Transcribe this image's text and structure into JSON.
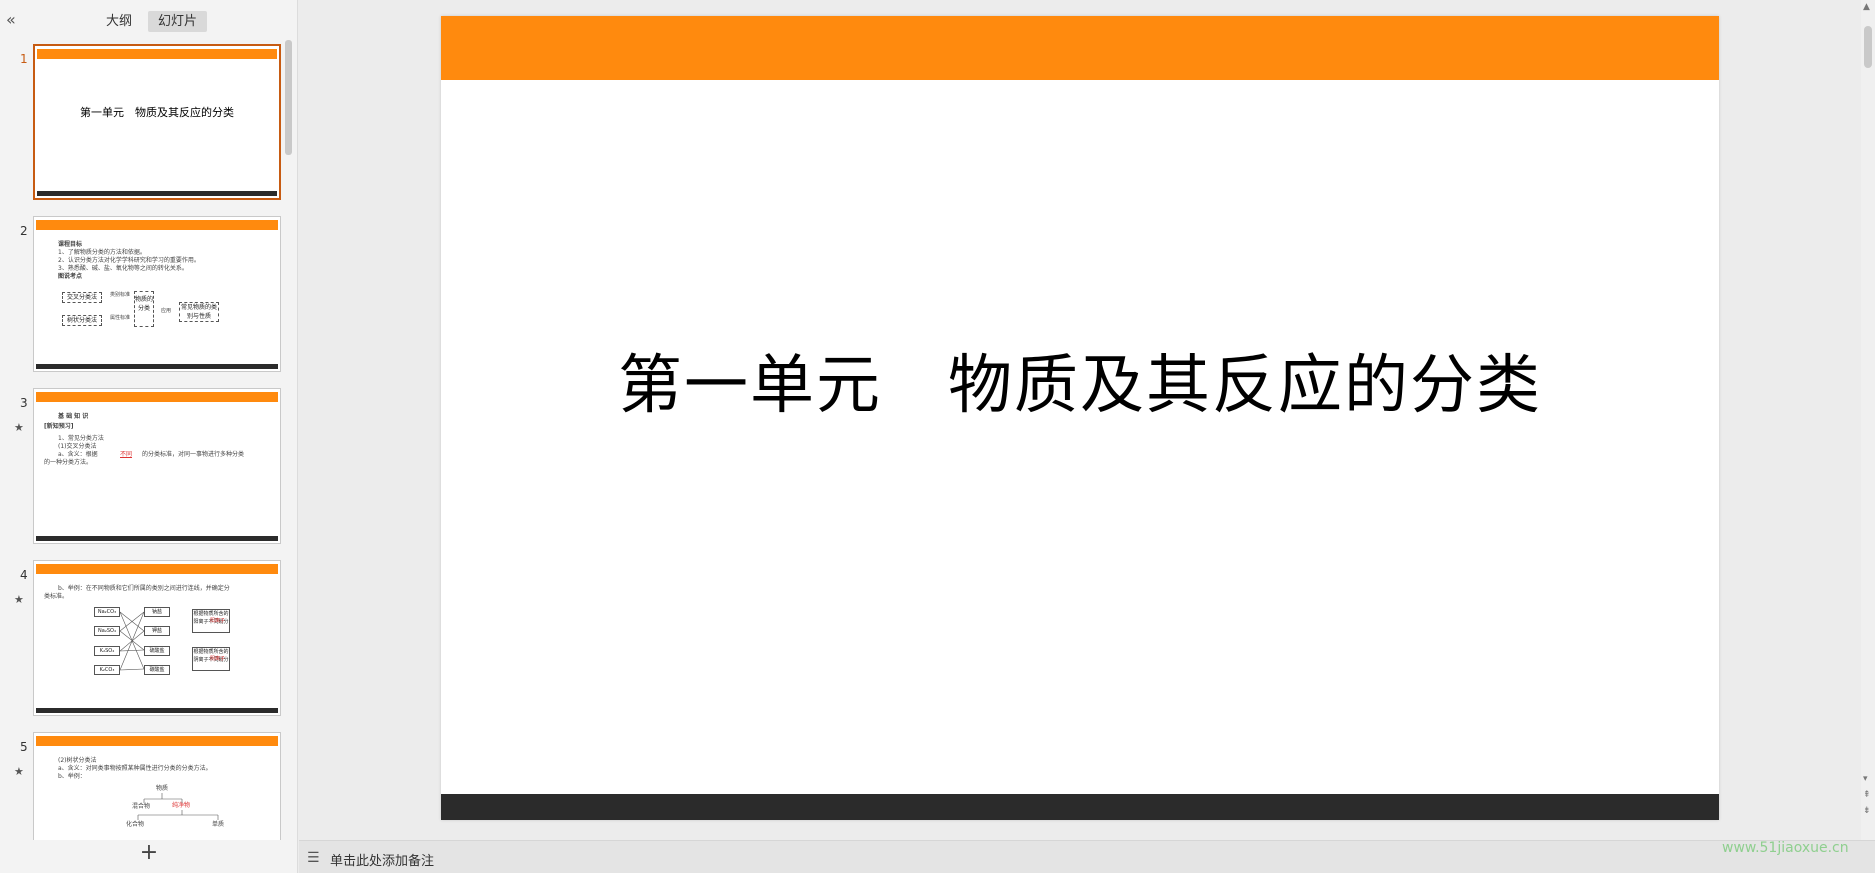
{
  "left_panel": {
    "collapse_icon": "«",
    "tabs": [
      {
        "label": "大纲",
        "active": false
      },
      {
        "label": "幻灯片",
        "active": true
      }
    ],
    "add_icon": "+"
  },
  "thumbnails": [
    {
      "number": "1",
      "title": "第一单元　物质及其反应的分类"
    },
    {
      "number": "2",
      "lines": [
        "课程目标",
        "1、了解物质分类的方法和依据。",
        "2、认识分类方法对化学学科研究和学习的重要作用。",
        "3、熟悉酸、碱、盐、氧化物等之间的转化关系。",
        "图说考点"
      ],
      "boxes": [
        "交叉分类法",
        "树状分类法",
        "物质的分类",
        "常见物质的类别与性质"
      ],
      "small": [
        "类别标准",
        "属性标准",
        "应用"
      ]
    },
    {
      "number": "3",
      "star": "★",
      "lines": [
        "基 础 知 识",
        "[新知预习]",
        "1、常见分类方法",
        "(1)交叉分类法",
        "a、含义：根据",
        "的分类标准，对同一事物进行多种分类",
        "的一种分类方法。"
      ],
      "blank": "不同"
    },
    {
      "number": "4",
      "star": "★",
      "lines": [
        "b、举例：在不同物质和它们所属的类别之间进行连线，并确定分",
        "类标准。"
      ],
      "left_items": [
        "Na₂CO₃",
        "Na₂SO₄",
        "K₂SO₄",
        "K₂CO₃"
      ],
      "mid_items": [
        "钠盐",
        "钾盐",
        "硫酸盐",
        "碳酸盐"
      ],
      "right_items": [
        "根据物质所含的阳离子不同划分",
        "根据物质所含的阴离子不同划分"
      ],
      "right_blanks": [
        "阳离子",
        "阴离子"
      ]
    },
    {
      "number": "5",
      "star": "★",
      "lines": [
        "(2)树状分类法",
        "a、含义：对同类事物按照某种属性进行分类的分类方法。",
        "b、举例："
      ],
      "tree": [
        "物质",
        "混合物",
        "化合物",
        "单质"
      ],
      "tree_blank": "纯净物"
    }
  ],
  "slide": {
    "title": "第一单元　物质及其反应的分类"
  },
  "scrollbar": {
    "up_icon": "▲",
    "nav_icons": [
      "▾",
      "⇞",
      "⇟"
    ]
  },
  "notes": {
    "icon": "☰",
    "placeholder": "单击此处添加备注"
  },
  "watermark": "www.51jiaoxue.cn",
  "colors": {
    "accent_orange": "#ff8a0e",
    "dark_bar": "#2b2b2b",
    "selected_border": "#c75b12"
  }
}
